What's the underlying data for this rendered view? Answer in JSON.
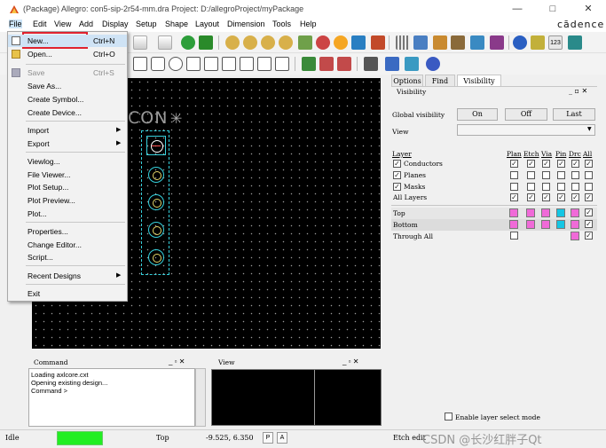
{
  "window": {
    "title": "(Package) Allegro: con5-sip-2r54-mm.dra  Project: D:/allegroProject/myPackage",
    "minimize_glyph": "—",
    "maximize_glyph": "□",
    "close_glyph": "✕"
  },
  "menubar": {
    "items": [
      "File",
      "Edit",
      "View",
      "Add",
      "Display",
      "Setup",
      "Shape",
      "Layout",
      "Dimension",
      "Tools",
      "Help"
    ],
    "brand": "cādence"
  },
  "file_menu": {
    "items": [
      {
        "label": "New...",
        "shortcut": "Ctrl+N",
        "icon": "new-file-icon"
      },
      {
        "label": "Open...",
        "shortcut": "Ctrl+O",
        "icon": "open-folder-icon"
      },
      {
        "label": "Save",
        "shortcut": "Ctrl+S",
        "icon": "save-icon",
        "disabled": true
      },
      {
        "label": "Save As..."
      },
      {
        "label": "Create Symbol..."
      },
      {
        "label": "Create Device..."
      },
      {
        "label": "Import",
        "submenu": true
      },
      {
        "label": "Export",
        "submenu": true
      },
      {
        "label": "Viewlog..."
      },
      {
        "label": "File Viewer..."
      },
      {
        "label": "Plot Setup..."
      },
      {
        "label": "Plot Preview..."
      },
      {
        "label": "Plot..."
      },
      {
        "label": "Properties..."
      },
      {
        "label": "Change Editor..."
      },
      {
        "label": "Script..."
      },
      {
        "label": "Recent Designs",
        "submenu": true
      },
      {
        "label": "Exit"
      }
    ],
    "submenu_arrow": "▶"
  },
  "toolbar": {
    "ratsnest_label": "123"
  },
  "canvas": {
    "refdes": "CON",
    "origin_marker": "✳"
  },
  "panel": {
    "tabs": [
      "Options",
      "Find",
      "Visibility"
    ],
    "header": "Visibility",
    "header_controls": "_ ▫ ✕",
    "global_visibility_label": "Global visibility",
    "btn_on": "On",
    "btn_off": "Off",
    "btn_last": "Last",
    "view_label": "View",
    "view_value": "",
    "dropdown_arrow": "▼",
    "layer_header": "Layer",
    "column_headers": [
      "Plan",
      "Etch",
      "Via",
      "Pin",
      "Drc",
      "All"
    ],
    "layer_groups": [
      {
        "name": "Conductors",
        "checked": true
      },
      {
        "name": "Planes",
        "checked": true
      },
      {
        "name": "Masks",
        "checked": true
      },
      {
        "name": "All Layers",
        "checked": false
      }
    ],
    "layers": [
      {
        "name": "Top"
      },
      {
        "name": "Bottom"
      },
      {
        "name": "Through All"
      }
    ],
    "enable_layer_select": "Enable layer select mode",
    "check_glyph": "✓"
  },
  "command_pane": {
    "title": "Command",
    "controls": "_ ▫ ✕",
    "lines": [
      "Loading axlcore.cxt",
      "Opening existing design...",
      "Command >"
    ]
  },
  "view_pane": {
    "title": "View",
    "controls": "_ ▫ ✕"
  },
  "statusbar": {
    "state": "Idle",
    "active_layer": "Top",
    "coordinates": "-9.525, 6.350",
    "btn_p": "P",
    "btn_a": "A",
    "mode": "Etch edit",
    "watermark": "CSDN @长沙红胖子Qt"
  },
  "colors": {
    "highlight": "#e0232f",
    "pad_outline": "#35d0dc",
    "idle_green": "#22ee22",
    "swatch_pink": "#f06ad8",
    "swatch_cyan": "#14c6e4"
  }
}
